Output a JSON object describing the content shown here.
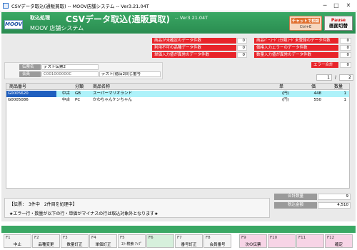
{
  "window": {
    "title": "CSVデータ取込(通販買取) -- MOOV店舗システム -- Ver3.21.04T",
    "minimize_glyph": "─",
    "maximize_glyph": "□",
    "close_glyph": "✕"
  },
  "header": {
    "logo_text": "MOOV",
    "section_label": "取込処理",
    "screen_title": "CSVデータ取込(通販買取)",
    "version": "-- Ver3.21.04T",
    "system_name": "MOOV 店舗システム",
    "chat_button": {
      "line1": "チャットで相談",
      "line2": "Ctrl+E"
    },
    "pause_button": {
      "line1": "Pause",
      "line2": "画面切替"
    }
  },
  "stats_left": [
    {
      "label": "商品が未確定のデータ件数",
      "value": "0"
    },
    {
      "label": "利用不可の品種データ件数",
      "value": "0"
    },
    {
      "label": "単価入力値が異常のデータ件数",
      "value": "0"
    }
  ],
  "stats_right": [
    {
      "label": "商品ﾊﾞｰｺｰﾄﾞ/分類ｺｰﾄﾞ未登録のデータ件数",
      "value": "0"
    },
    {
      "label": "価格入力エラーのデータ件数",
      "value": "0"
    },
    {
      "label": "数量入力値が異常のデータ件数",
      "value": "0"
    }
  ],
  "error_total": {
    "label": "エラー合計",
    "value": "0"
  },
  "pager": {
    "current": "1",
    "separator": "/",
    "total": "2"
  },
  "slip": {
    "slip_name_label": "伝票名",
    "slip_name_value": "テスト伝票2",
    "member_label": "会員",
    "member_code": "C001000000C",
    "member_name": "テスト(徳店2同じ番号"
  },
  "table": {
    "headers": {
      "code": "商品番号",
      "category": "分類",
      "name": "商品名称",
      "unit": "単",
      "price": "価",
      "qty": "数量"
    },
    "rows": [
      {
        "code": "G0005620",
        "category": "中古",
        "sub": "GB",
        "name": "スーパーマリオランド",
        "unit": "(円)",
        "price": "448",
        "qty": "1"
      },
      {
        "code": "G0005086",
        "category": "中古",
        "sub": "PC",
        "name": "かわちゃんケンちゃん",
        "unit": "(円)",
        "price": "550",
        "qty": "1"
      }
    ]
  },
  "messages": {
    "line1": "【伝票：　3件中　2件目を処理中】",
    "line2": "★エラー行・数量が以下の行・単価がマイナスの行は取込対象外となります★"
  },
  "totals": [
    {
      "label": "合計数量",
      "value": "9"
    },
    {
      "label": "税込金額",
      "value": "4,510"
    }
  ],
  "fkeys": [
    {
      "key": "F1",
      "label": "中止",
      "color": "default"
    },
    {
      "key": "F2",
      "label": "品種変更",
      "color": "default"
    },
    {
      "key": "F3",
      "label": "数量訂正",
      "color": "default"
    },
    {
      "key": "F4",
      "label": "単価訂正",
      "color": "default"
    },
    {
      "key": "F5",
      "label": "ｴﾗｰ検索 ｱｯﾌﾟ",
      "color": "default"
    },
    {
      "key": "F6",
      "label": "",
      "color": "green"
    },
    {
      "key": "F7",
      "label": "番号訂正",
      "color": "default"
    },
    {
      "key": "F8",
      "label": "会員番号",
      "color": "default"
    },
    {
      "key": "F9",
      "label": "次の伝票",
      "color": "pink"
    },
    {
      "key": "F10",
      "label": "",
      "color": "pink"
    },
    {
      "key": "F11",
      "label": "",
      "color": "pink"
    },
    {
      "key": "F12",
      "label": "確定",
      "color": "pink"
    }
  ]
}
